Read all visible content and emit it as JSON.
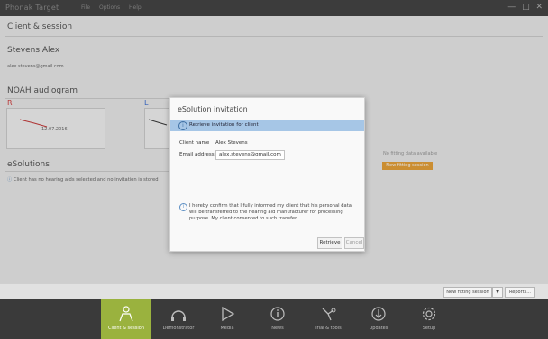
{
  "titlebar": {
    "app": "Phonak Target",
    "menu": [
      "File",
      "Options",
      "Help"
    ],
    "controls": [
      "—",
      "□",
      "✕"
    ]
  },
  "client_session": {
    "title": "Client & session"
  },
  "client": {
    "name": "Stevens Alex",
    "email": "alex.stevens@gmail.com"
  },
  "audiogram": {
    "title": "NOAH audiogram",
    "right_mark": "R",
    "left_mark": "L",
    "date": "12.07.2016"
  },
  "esolutions": {
    "title": "eSolutions",
    "message": "Client has no hearing aids selected and no invitation is stored"
  },
  "right_panel": {
    "note": "No fitting data available",
    "button": "New fitting session"
  },
  "footer": {
    "new_fitting": "New fitting session",
    "dropdown": "▼",
    "reports": "Reports..."
  },
  "dialog": {
    "title": "eSolution invitation",
    "band": "Retrieve invitation for client",
    "client_name_label": "Client name",
    "client_name": "Alex Stevens",
    "email_label": "Email address",
    "email_value": "alex.stevens@gmail.com",
    "consent": "I hereby confirm that I fully informed my client that his personal data will be transferred to the hearing aid manufacturer for processing purpose. My client consented to such transfer.",
    "retrieve": "Retrieve",
    "cancel": "Cancel"
  },
  "nav": [
    {
      "label": "Client & session",
      "icon": "person-icon",
      "active": true
    },
    {
      "label": "Demonstrator",
      "icon": "headphones-icon"
    },
    {
      "label": "Media",
      "icon": "play-icon"
    },
    {
      "label": "News",
      "icon": "info-icon"
    },
    {
      "label": "Trial & tools",
      "icon": "tools-icon"
    },
    {
      "label": "Updates",
      "icon": "download-icon"
    },
    {
      "label": "Setup",
      "icon": "gear-icon"
    }
  ],
  "colors": {
    "accent": "#9ab23e",
    "dialog_band": "#a6c6e6",
    "orange_button": "#e8a23a",
    "nav_bg": "#3a3a3a"
  }
}
